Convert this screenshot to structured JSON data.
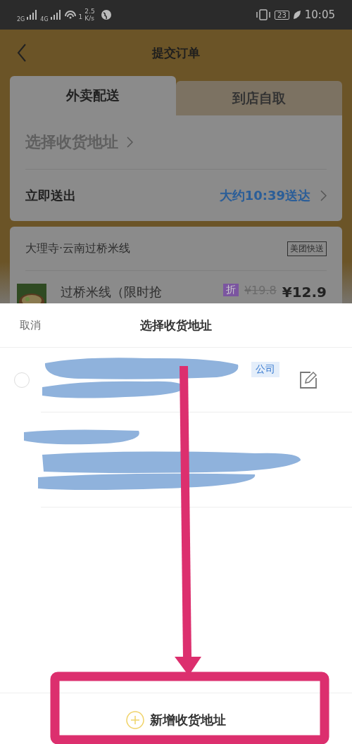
{
  "status_bar": {
    "network_1": "2G",
    "network_2": "4G",
    "wifi_badge": "1",
    "speed": "2.5",
    "speed_unit": "K/s",
    "battery": "23",
    "time": "10:05"
  },
  "header": {
    "title": "提交订单"
  },
  "tabs": [
    {
      "label": "外卖配送",
      "selected": true
    },
    {
      "label": "到店自取",
      "selected": false
    }
  ],
  "delivery": {
    "address_prompt": "选择收货地址",
    "time_label": "立即送出",
    "eta": "大约10:39送达"
  },
  "shop": {
    "name": "大理寺·云南过桥米线",
    "badge": "美团快送",
    "item": {
      "name": "过桥米线（限时抢",
      "discount_tag": "折",
      "original_price": "¥19.8",
      "price": "¥12.9"
    }
  },
  "sheet": {
    "cancel": "取消",
    "title": "选择收货地址",
    "addresses": [
      {
        "kind": "selectable",
        "selected": false,
        "tag": "公司"
      },
      {
        "kind": "plain"
      }
    ],
    "add_button": "新增收货地址"
  }
}
